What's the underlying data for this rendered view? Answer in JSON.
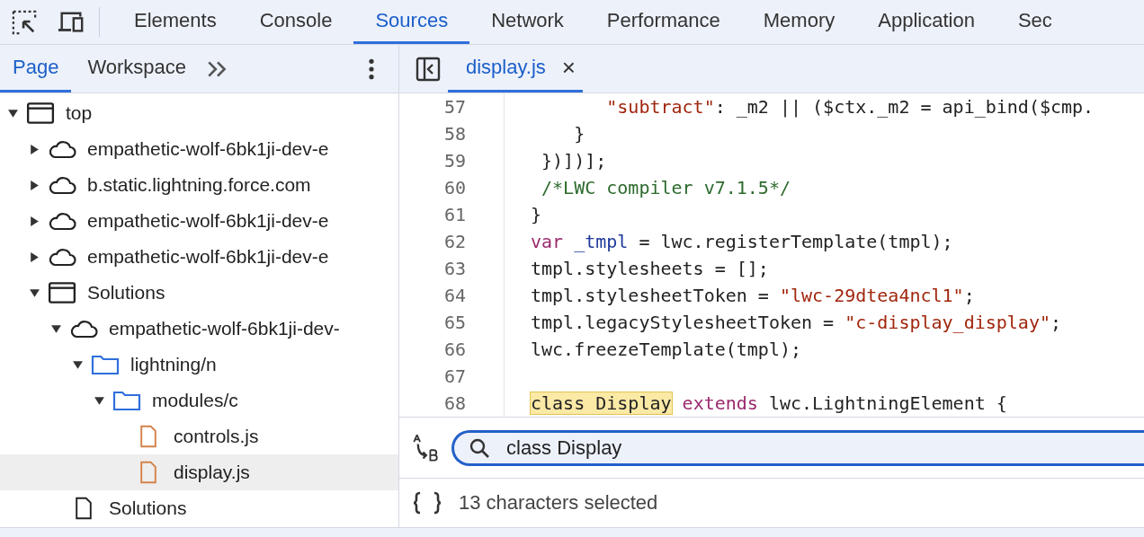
{
  "main_tabs": [
    {
      "label": "Elements",
      "selected": false
    },
    {
      "label": "Console",
      "selected": false
    },
    {
      "label": "Sources",
      "selected": true
    },
    {
      "label": "Network",
      "selected": false
    },
    {
      "label": "Performance",
      "selected": false
    },
    {
      "label": "Memory",
      "selected": false
    },
    {
      "label": "Application",
      "selected": false
    },
    {
      "label": "Sec",
      "selected": false
    }
  ],
  "navigator": {
    "tabs": [
      {
        "label": "Page",
        "selected": true
      },
      {
        "label": "Workspace",
        "selected": false
      }
    ],
    "tree": [
      {
        "kind": "frame",
        "label": "top",
        "expanded": true,
        "selected": false,
        "children": [
          {
            "kind": "cloud",
            "label": "empathetic-wolf-6bk1ji-dev-e",
            "expanded": false,
            "selected": false
          },
          {
            "kind": "cloud",
            "label": "b.static.lightning.force.com",
            "expanded": false,
            "selected": false
          },
          {
            "kind": "cloud",
            "label": "empathetic-wolf-6bk1ji-dev-e",
            "expanded": false,
            "selected": false
          },
          {
            "kind": "cloud",
            "label": "empathetic-wolf-6bk1ji-dev-e",
            "expanded": false,
            "selected": false
          },
          {
            "kind": "frame",
            "label": "Solutions",
            "expanded": true,
            "selected": false,
            "children": [
              {
                "kind": "cloud",
                "label": "empathetic-wolf-6bk1ji-dev-",
                "expanded": true,
                "selected": false,
                "children": [
                  {
                    "kind": "folder",
                    "label": "lightning/n",
                    "expanded": true,
                    "selected": false,
                    "children": [
                      {
                        "kind": "folder",
                        "label": "modules/c",
                        "expanded": true,
                        "selected": false,
                        "children": [
                          {
                            "kind": "script",
                            "label": "controls.js",
                            "selected": false
                          },
                          {
                            "kind": "script",
                            "label": "display.js",
                            "selected": true
                          }
                        ]
                      }
                    ]
                  }
                ]
              },
              {
                "kind": "document",
                "label": "Solutions",
                "selected": false
              }
            ]
          }
        ]
      }
    ]
  },
  "editor": {
    "file_tab": {
      "label": "display.js",
      "close": "×"
    },
    "lines": [
      {
        "number": "57",
        "tokens": [
          {
            "kind": "string",
            "text": "       \"subtract\""
          },
          {
            "kind": "plain",
            "text": ": _m2 || ($ctx._m2 = api_bind($cmp."
          }
        ]
      },
      {
        "number": "58",
        "tokens": [
          {
            "kind": "plain",
            "text": "    }"
          }
        ]
      },
      {
        "number": "59",
        "tokens": [
          {
            "kind": "plain",
            "text": " })])];"
          }
        ]
      },
      {
        "number": "60",
        "tokens": [
          {
            "kind": "comment",
            "text": " /*LWC compiler v7.1.5*/"
          }
        ]
      },
      {
        "number": "61",
        "tokens": [
          {
            "kind": "plain",
            "text": "}"
          }
        ]
      },
      {
        "number": "62",
        "tokens": [
          {
            "kind": "keyword",
            "text": "var"
          },
          {
            "kind": "variable",
            "text": " _tmpl"
          },
          {
            "kind": "plain",
            "text": " = lwc.registerTemplate(tmpl);"
          }
        ]
      },
      {
        "number": "63",
        "tokens": [
          {
            "kind": "plain",
            "text": "tmpl.stylesheets = [];"
          }
        ]
      },
      {
        "number": "64",
        "tokens": [
          {
            "kind": "plain",
            "text": "tmpl.stylesheetToken = "
          },
          {
            "kind": "string",
            "text": "\"lwc-29dtea4ncl1\""
          },
          {
            "kind": "plain",
            "text": ";"
          }
        ]
      },
      {
        "number": "65",
        "tokens": [
          {
            "kind": "plain",
            "text": "tmpl.legacyStylesheetToken = "
          },
          {
            "kind": "string",
            "text": "\"c-display_display\""
          },
          {
            "kind": "plain",
            "text": ";"
          }
        ]
      },
      {
        "number": "66",
        "tokens": [
          {
            "kind": "plain",
            "text": "lwc.freezeTemplate(tmpl);"
          }
        ]
      },
      {
        "number": "67"
      },
      {
        "number": "68",
        "tokens": [
          {
            "kind": "match",
            "text": "class Display"
          },
          {
            "kind": "keyword",
            "text": " extends"
          },
          {
            "kind": "plain",
            "text": " lwc.LightningElement {"
          }
        ]
      }
    ],
    "search": {
      "value": "class Display"
    },
    "status": "13 characters selected"
  }
}
